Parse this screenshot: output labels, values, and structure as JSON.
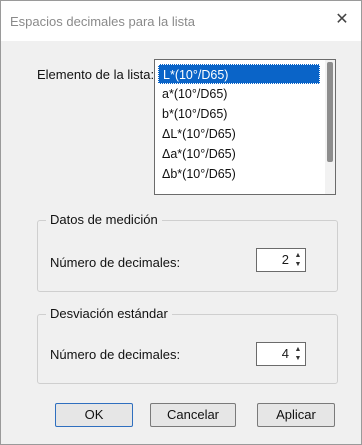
{
  "dialog": {
    "title": "Espacios decimales para la lista",
    "close_glyph": "✕",
    "close_icon": "close-icon"
  },
  "list": {
    "label": "Elemento de la lista:",
    "items": [
      "L*(10°/D65)",
      "a*(10°/D65)",
      "b*(10°/D65)",
      "ΔL*(10°/D65)",
      "Δa*(10°/D65)",
      "Δb*(10°/D65)"
    ],
    "selected_index": 0
  },
  "measurement": {
    "group_title": "Datos de medición",
    "field_label": "Número de decimales:",
    "value": "2"
  },
  "stddev": {
    "group_title": "Desviación estándar",
    "field_label": "Número de decimales:",
    "value": "4"
  },
  "spin_icons": {
    "up": "▲",
    "down": "▼"
  },
  "buttons": {
    "ok": "OK",
    "cancel": "Cancelar",
    "apply": "Aplicar"
  }
}
